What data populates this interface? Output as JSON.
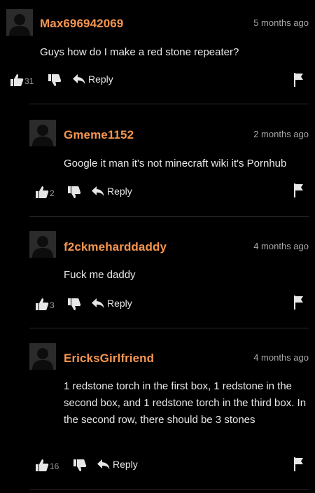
{
  "colors": {
    "background": "#000000",
    "username": "#f5964f",
    "timestamp": "#a9a9a9",
    "text": "#e8e8e8",
    "icon": "#e6e6e6",
    "divider": "#2c2c2c"
  },
  "comments": [
    {
      "username": "Max696942069",
      "time": "5 months ago",
      "text": "Guys how do I make a red stone repeater?",
      "likes": "31",
      "reply_label": "Reply"
    },
    {
      "username": "Gmeme1152",
      "time": "2 months ago",
      "text": "Google it man it's not minecraft wiki it's Pornhub",
      "likes": "2",
      "reply_label": "Reply"
    },
    {
      "username": "f2ckmeharddaddy",
      "time": "4 months ago",
      "text": "Fuck me daddy",
      "likes": "3",
      "reply_label": "Reply"
    },
    {
      "username": "EricksGirlfriend",
      "time": "4 months ago",
      "text": "1 redstone torch in the first box, 1 redstone in the second box, and 1 redstone torch in the third box. In the second row, there should be 3 stones",
      "likes": "16",
      "reply_label": "Reply"
    }
  ],
  "icons": {
    "like": "thumbs-up-icon",
    "dislike": "thumbs-down-icon",
    "reply": "reply-arrow-icon",
    "flag": "flag-icon",
    "avatar": "default-avatar-icon"
  }
}
